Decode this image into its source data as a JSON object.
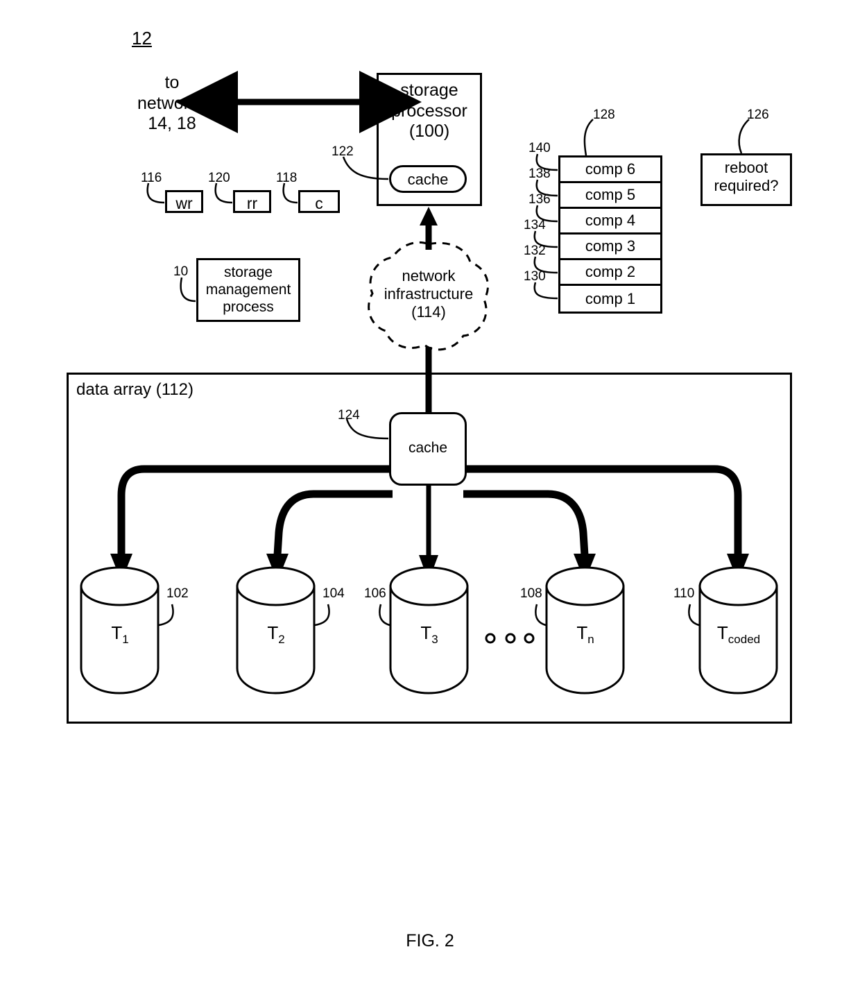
{
  "figure": {
    "number_label": "12",
    "caption": "FIG. 2"
  },
  "networks": {
    "label": "to\nnetworks\n14, 18"
  },
  "storage_processor": {
    "label": "storage\nprocessor\n(100)",
    "cache_label": "cache",
    "cache_ref": "122"
  },
  "io_boxes": [
    {
      "label": "wr",
      "ref": "116"
    },
    {
      "label": "rr",
      "ref": "120"
    },
    {
      "label": "c",
      "ref": "118"
    }
  ],
  "storage_management_process": {
    "label": "storage\nmanagement\nprocess",
    "ref": "10"
  },
  "network_infrastructure": {
    "label": "network\ninfrastructure\n(114)"
  },
  "component_stack": {
    "stack_ref": "128",
    "rows": [
      {
        "label": "comp 6",
        "ref": "140"
      },
      {
        "label": "comp 5",
        "ref": "138"
      },
      {
        "label": "comp 4",
        "ref": "136"
      },
      {
        "label": "comp 3",
        "ref": "134"
      },
      {
        "label": "comp 2",
        "ref": "132"
      },
      {
        "label": "comp 1",
        "ref": "130"
      }
    ]
  },
  "reboot_required": {
    "label": "reboot\nrequired?",
    "ref": "126"
  },
  "data_array": {
    "label": "data array (112)",
    "cache_label": "cache",
    "cache_ref": "124",
    "ellipsis": "○ ○ ○",
    "targets": [
      {
        "base": "T",
        "sub": "1",
        "ref": "102"
      },
      {
        "base": "T",
        "sub": "2",
        "ref": "104"
      },
      {
        "base": "T",
        "sub": "3",
        "ref": "106"
      },
      {
        "base": "T",
        "sub": "n",
        "ref": "108"
      },
      {
        "base": "T",
        "sub": "coded",
        "ref": "110"
      }
    ]
  },
  "colors": {
    "stroke": "#000000",
    "background": "#ffffff"
  }
}
